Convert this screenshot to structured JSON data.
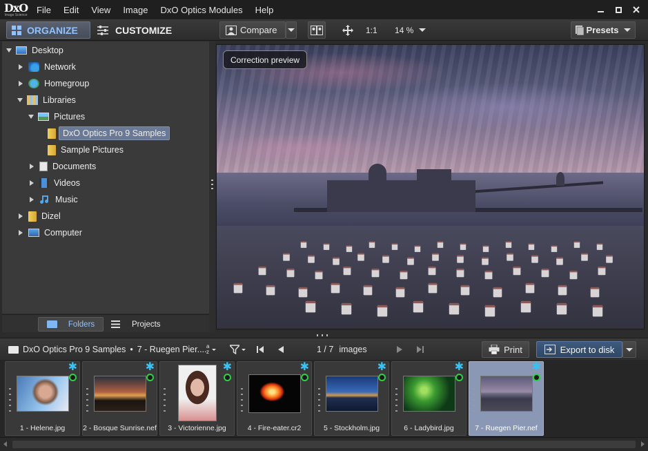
{
  "menubar": {
    "logo": "DxO",
    "logo_sub": "Image Science",
    "items": [
      "File",
      "Edit",
      "View",
      "Image",
      "DxO Optics Modules",
      "Help"
    ]
  },
  "toolbar": {
    "organize": "ORGANIZE",
    "customize": "CUSTOMIZE",
    "compare": "Compare",
    "ratio": "1:1",
    "zoom": "14 %",
    "presets": "Presets"
  },
  "tree": [
    {
      "label": "Desktop"
    },
    {
      "label": "Network"
    },
    {
      "label": "Homegroup"
    },
    {
      "label": "Libraries"
    },
    {
      "label": "Pictures"
    },
    {
      "label": "DxO Optics Pro 9 Samples"
    },
    {
      "label": "Sample Pictures"
    },
    {
      "label": "Documents"
    },
    {
      "label": "Videos"
    },
    {
      "label": "Music"
    },
    {
      "label": "Dizel"
    },
    {
      "label": "Computer"
    }
  ],
  "left_tabs": {
    "folders": "Folders",
    "projects": "Projects"
  },
  "preview": {
    "badge": "Correction preview"
  },
  "strip": {
    "breadcrumb_folder": "DxO Optics Pro 9 Samples",
    "breadcrumb_sep": "•",
    "breadcrumb_file": "7 - Ruegen Pier....",
    "sort_top": "a",
    "sort_bottom": "z",
    "counter": "1 / 7",
    "counter_unit": "images",
    "print": "Print",
    "export": "Export to disk"
  },
  "thumbnails": [
    {
      "caption": "1 - Helene.jpg"
    },
    {
      "caption": "2 - Bosque Sunrise.nef"
    },
    {
      "caption": "3 - Victorienne.jpg"
    },
    {
      "caption": "4 - Fire-eater.cr2"
    },
    {
      "caption": "5 - Stockholm.jpg"
    },
    {
      "caption": "6 - Ladybird.jpg"
    },
    {
      "caption": "7 - Ruegen Pier.nef"
    }
  ],
  "colors": {
    "accent": "#38c2f0",
    "status_ok": "#2dd045",
    "selection": "#6a7a96"
  }
}
